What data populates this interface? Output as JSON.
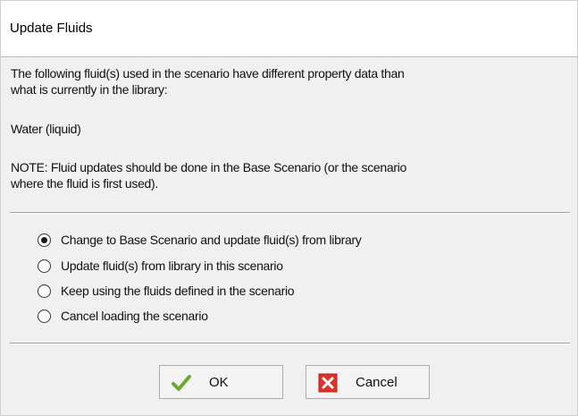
{
  "dialog": {
    "title": "Update Fluids",
    "message_line1": "The following fluid(s) used in the scenario have different property data than",
    "message_line2": "what is currently in the library:",
    "fluid_name": "Water (liquid)",
    "note_line1": "NOTE: Fluid updates should be done in the Base Scenario (or the scenario",
    "note_line2": "where the fluid is first used)."
  },
  "options": [
    {
      "label": "Change to Base Scenario and update fluid(s) from library",
      "selected": true
    },
    {
      "label": "Update fluid(s) from library in this scenario",
      "selected": false
    },
    {
      "label": "Keep using the fluids defined in the scenario",
      "selected": false
    },
    {
      "label": "Cancel loading the scenario",
      "selected": false
    }
  ],
  "buttons": {
    "ok_label": "OK",
    "ok_icon": "checkmark-icon",
    "cancel_label": "Cancel",
    "cancel_icon": "red-x-icon"
  },
  "colors": {
    "ok_check": "#6aab2e",
    "cancel_red": "#e0302a"
  }
}
